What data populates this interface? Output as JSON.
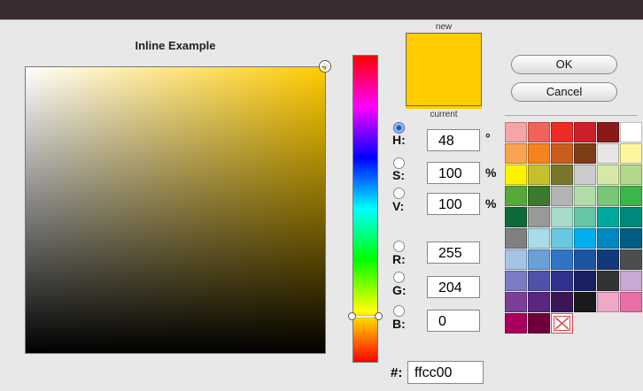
{
  "window": {
    "title": "Inline Example"
  },
  "preview": {
    "new_label": "new",
    "current_label": "current",
    "new_color": "#ffcc00",
    "current_color": "#ffcc00"
  },
  "fields": {
    "h": {
      "label": "H:",
      "value": "48",
      "unit": "°"
    },
    "s": {
      "label": "S:",
      "value": "100",
      "unit": "%"
    },
    "v": {
      "label": "V:",
      "value": "100",
      "unit": "%"
    },
    "r": {
      "label": "R:",
      "value": "255"
    },
    "g": {
      "label": "G:",
      "value": "204"
    },
    "b": {
      "label": "B:",
      "value": "0"
    }
  },
  "hex": {
    "label": "#:",
    "value": "ffcc00"
  },
  "buttons": {
    "ok": "OK",
    "cancel": "Cancel"
  },
  "selected_mode": "h",
  "palette": [
    "#f5a4a8",
    "#f0635a",
    "#ee2a24",
    "#cc1e2b",
    "#8a1a1a",
    "#ffffff",
    "#fbd0a0",
    "#f9a350",
    "#f5821f",
    "#c85d1e",
    "#7a3e18",
    "#e6e6e6",
    "#fdf5a0",
    "#faf15a",
    "#fff200",
    "#c8c02a",
    "#78762a",
    "#cccccc",
    "#d6e8a8",
    "#b4d88a",
    "#8dc63f",
    "#57a83a",
    "#3c7a2e",
    "#b3b3b3",
    "#b3dba6",
    "#79c57a",
    "#3cb54a",
    "#1a9a48",
    "#0f6a3a",
    "#999999",
    "#a8dcc8",
    "#66c5a4",
    "#00a99d",
    "#00887a",
    "#005a50",
    "#808080",
    "#a8dcea",
    "#69c7e0",
    "#00aeef",
    "#0088c0",
    "#005e85",
    "#666666",
    "#a4c4e6",
    "#6a9fd8",
    "#2e75c6",
    "#1b55a4",
    "#12397a",
    "#4d4d4d",
    "#b0aedc",
    "#7b7bc4",
    "#4e53a8",
    "#2e3390",
    "#1b1f63",
    "#333333",
    "#c9a8d4",
    "#9d74b6",
    "#7a3f98",
    "#5a2680",
    "#3a1656",
    "#1a1a1a",
    "#f0a8c8",
    "#e96fa6",
    "#e0007a",
    "#a8005c",
    "#70003c",
    "none"
  ]
}
